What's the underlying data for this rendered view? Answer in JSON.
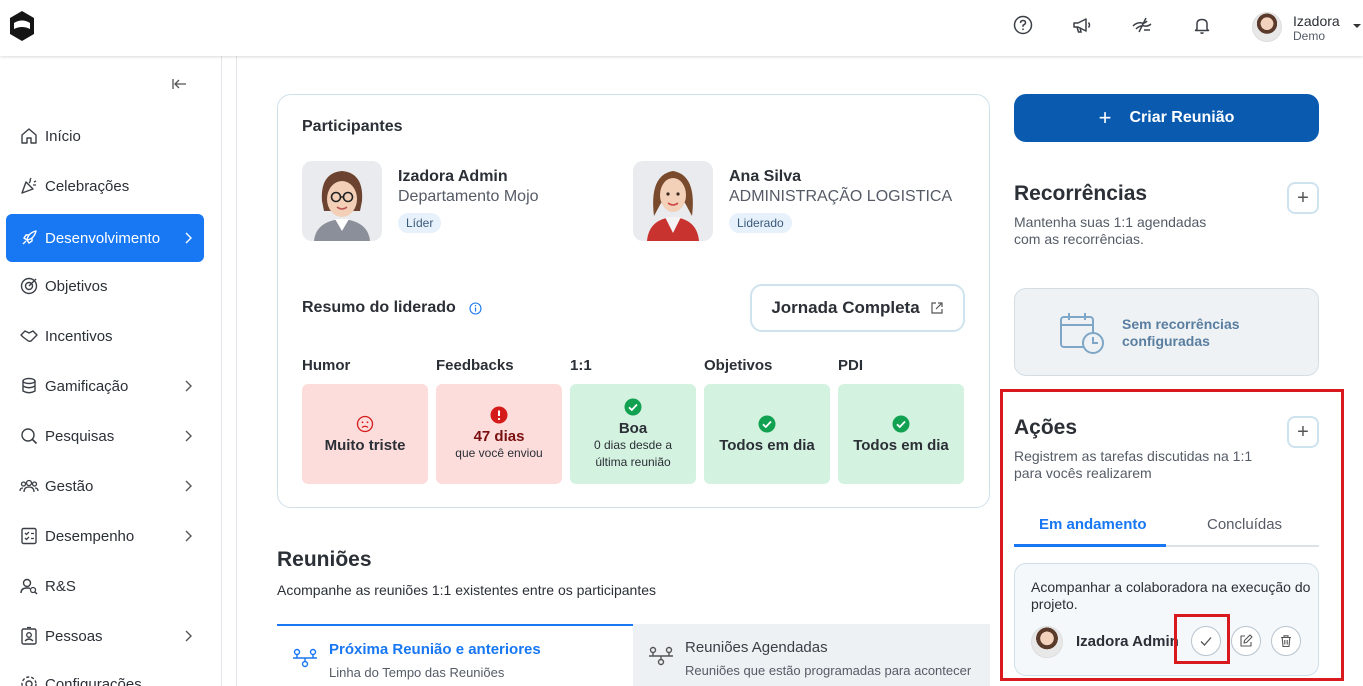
{
  "header": {
    "user_name": "Izadora",
    "user_sub": "Demo",
    "icons": [
      "help-icon",
      "megaphone-icon",
      "accessibility-icon",
      "bell-icon"
    ]
  },
  "sidebar": {
    "items": [
      {
        "label": "Início",
        "icon": "home-icon"
      },
      {
        "label": "Celebrações",
        "icon": "party-icon"
      },
      {
        "label": "Desenvolvimento",
        "icon": "rocket-icon",
        "active": true
      },
      {
        "label": "Objetivos",
        "icon": "target-icon"
      },
      {
        "label": "Incentivos",
        "icon": "handshake-icon"
      },
      {
        "label": "Gamificação",
        "icon": "coins-icon"
      },
      {
        "label": "Pesquisas",
        "icon": "search-icon"
      },
      {
        "label": "Gestão",
        "icon": "people-icon"
      },
      {
        "label": "Desempenho",
        "icon": "checklist-icon"
      },
      {
        "label": "R&S",
        "icon": "user-search-icon"
      },
      {
        "label": "Pessoas",
        "icon": "id-card-icon"
      },
      {
        "label": "Configurações",
        "icon": "settings-icon"
      }
    ]
  },
  "participants": {
    "title": "Participantes",
    "people": [
      {
        "name": "Izadora Admin",
        "dept": "Departamento Mojo",
        "tag": "Líder"
      },
      {
        "name": "Ana Silva",
        "dept": "ADMINISTRAÇÃO LOGISTICA",
        "tag": "Liderado"
      }
    ]
  },
  "resumo": {
    "title": "Resumo do liderado",
    "jornada_label": "Jornada Completa",
    "columns": [
      {
        "label": "Humor",
        "main": "Muito triste",
        "sub": ""
      },
      {
        "label": "Feedbacks",
        "main": "47 dias",
        "sub": "que você enviou"
      },
      {
        "label": "1:1",
        "main": "Boa",
        "sub": "0 dias desde a",
        "sub2": "última reunião"
      },
      {
        "label": "Objetivos",
        "main": "Todos em dia",
        "sub": ""
      },
      {
        "label": "PDI",
        "main": "Todos em dia",
        "sub": ""
      }
    ],
    "colors": {
      "red_bg": "#fddcdc",
      "green_bg": "#d4f2e0",
      "green_icon": "#12a150",
      "red_icon": "#d51a1a"
    }
  },
  "reunioes": {
    "title": "Reuniões",
    "subtitle": "Acompanhe as reuniões 1:1 existentes entre os participantes",
    "tabs": [
      {
        "label": "Próxima Reunião e anteriores",
        "sub": "Linha do Tempo das Reuniões"
      },
      {
        "label": "Reuniões Agendadas",
        "sub": "Reuniões que estão programadas para acontecer"
      }
    ]
  },
  "right": {
    "criar_label": "Criar Reunião",
    "criar_plus": "+",
    "recorrencias": {
      "title": "Recorrências",
      "desc": "Mantenha suas 1:1 agendadas com as recorrências.",
      "empty_line1": "Sem recorrências",
      "empty_line2": "configuradas"
    },
    "acoes": {
      "title": "Ações",
      "desc": "Registrem as tarefas discutidas na 1:1 para vocês realizarem",
      "tabs": [
        "Em andamento",
        "Concluídas"
      ],
      "item_text": "Acompanhar a colaboradora na execução do projeto.",
      "item_owner": "Izadora Admin"
    },
    "plus_symbol": "+"
  },
  "brand_color": "#1877f2"
}
